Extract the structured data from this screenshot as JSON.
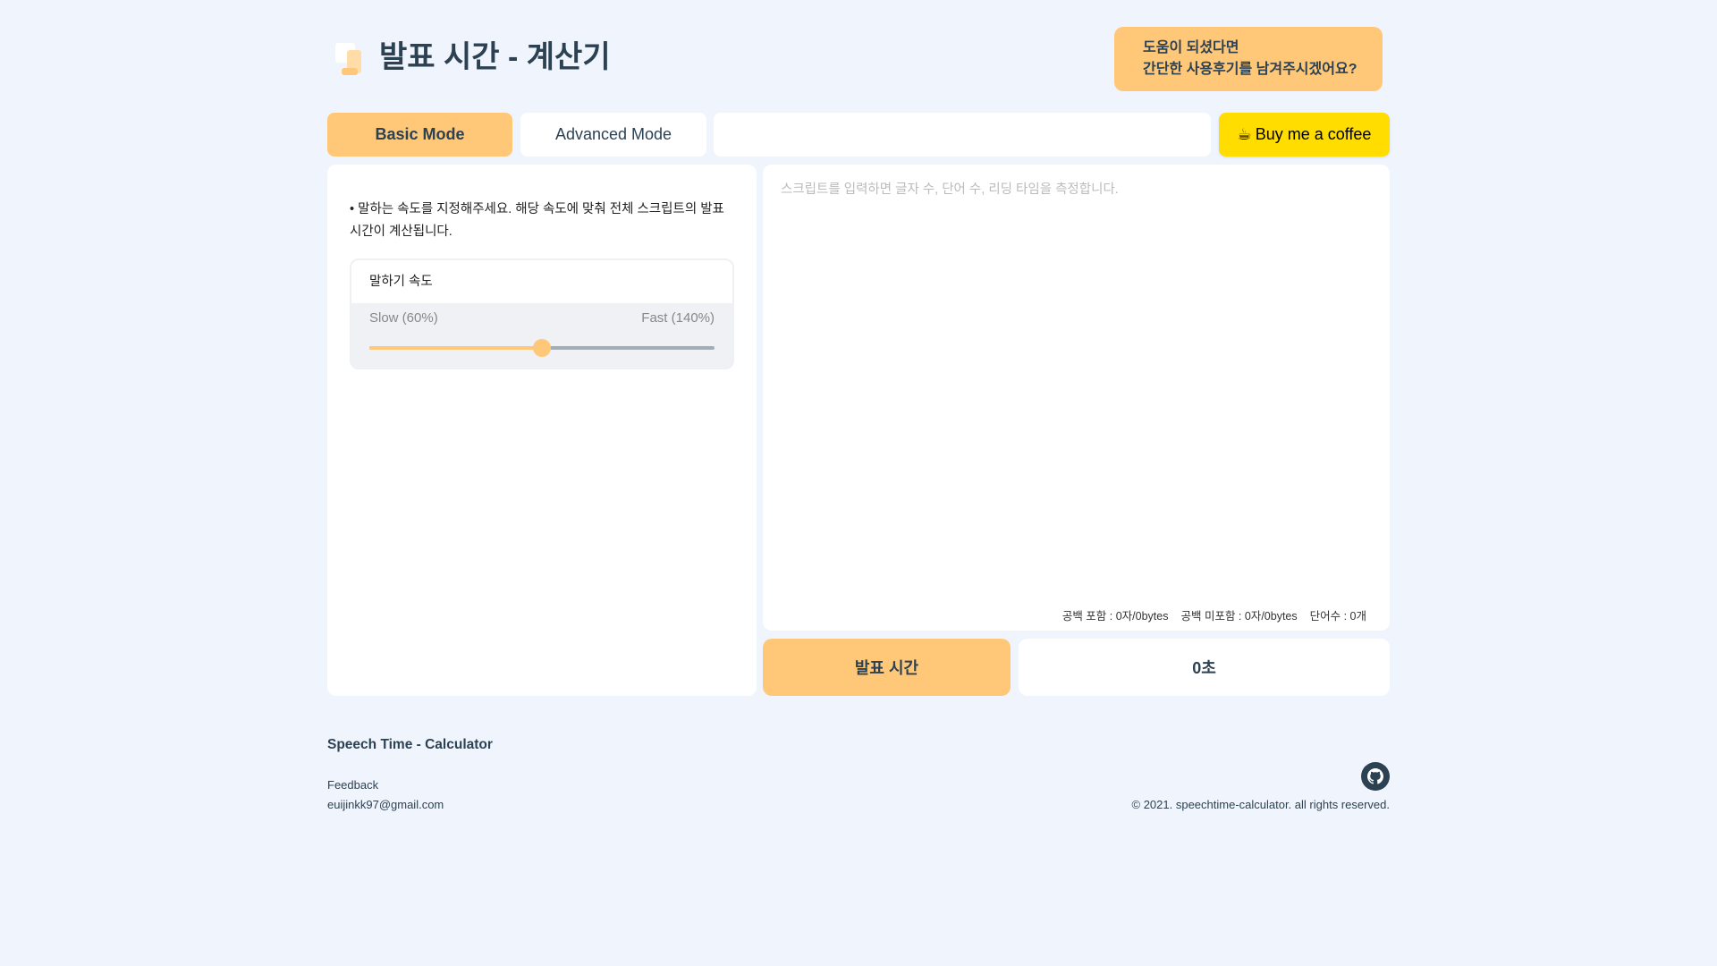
{
  "header": {
    "title": "발표 시간 - 계산기",
    "help_line1": "도움이 되셨다면",
    "help_line2": "간단한 사용후기를 남겨주시겠어요?"
  },
  "tabs": [
    {
      "label": "Basic Mode",
      "active": true
    },
    {
      "label": "Advanced Mode",
      "active": false
    }
  ],
  "coffee": {
    "icon": "☕",
    "label": "Buy me a coffee"
  },
  "left": {
    "description": "•  말하는 속도를 지정해주세요. 해당 속도에 맞춰 전체 스크립트의 발표 시간이 계산됩니다.",
    "speed_title": "말하기 속도",
    "slow_label": "Slow (60%)",
    "fast_label": "Fast (140%)",
    "speed_percent": 100,
    "speed_min": 60,
    "speed_max": 140
  },
  "script": {
    "placeholder": "스크립트를 입력하면 글자 수, 단어 수, 리딩 타임을 측정합니다.",
    "value": ""
  },
  "counts": {
    "with_space": "공백 포함 : 0자/0bytes",
    "without_space": "공백 미포함 : 0자/0bytes",
    "words": "단어수 : 0개"
  },
  "calc": {
    "button_label": "발표 시간",
    "result": "0초"
  },
  "footer": {
    "title": "Speech Time - Calculator",
    "feedback": "Feedback",
    "email": "euijinkk97@gmail.com",
    "copyright": "© 2021. speechtime-calculator. all rights reserved."
  },
  "colors": {
    "accent": "#ffc878",
    "coffee": "#ffdd00",
    "text": "#2c4152",
    "bg": "#f0f5fd"
  }
}
